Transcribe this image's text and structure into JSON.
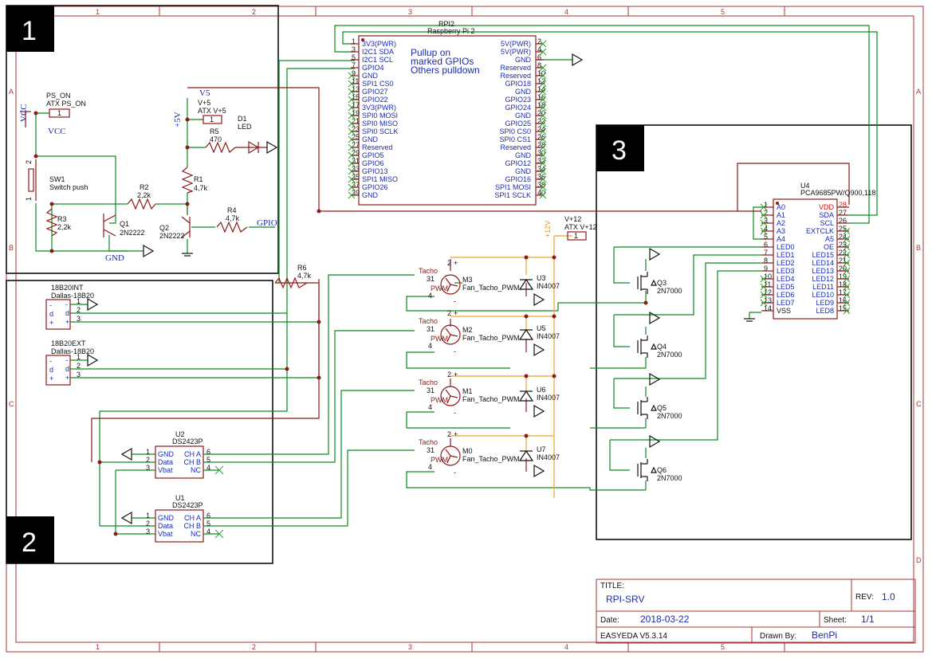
{
  "frame": {
    "cols": [
      "1",
      "2",
      "3",
      "4",
      "5"
    ],
    "rows": [
      "A",
      "B",
      "C",
      "D"
    ]
  },
  "sections": [
    "1",
    "2",
    "3"
  ],
  "title_block": {
    "title_label": "TITLE:",
    "title": "RPI-SRV",
    "rev_label": "REV:",
    "rev": "1.0",
    "date_label": "Date:",
    "date": "2018-03-22",
    "sheet_label": "Sheet:",
    "sheet": "1/1",
    "tool": "EASYEDA V5.3.14",
    "drawn_label": "Drawn By:",
    "drawn": "BenPi"
  },
  "rpi": {
    "ref": "RPI2",
    "name": "Raspberry Pi 2",
    "note1": "Pullup on",
    "note2": "marked GPIOs",
    "note3": "Others pulldown",
    "left_pins": [
      {
        "n": "1",
        "name": "3V3(PWR)"
      },
      {
        "n": "3",
        "name": "I2C1 SDA"
      },
      {
        "n": "5",
        "name": "I2C1 SCL"
      },
      {
        "n": "7",
        "name": "GPIO4"
      },
      {
        "n": "9",
        "name": "GND"
      },
      {
        "n": "11",
        "name": "SPI1 CS0"
      },
      {
        "n": "13",
        "name": "GPIO27"
      },
      {
        "n": "15",
        "name": "GPIO22"
      },
      {
        "n": "17",
        "name": "3V3(PWR)"
      },
      {
        "n": "19",
        "name": "SPI0 MOSI"
      },
      {
        "n": "21",
        "name": "SPI0 MISO"
      },
      {
        "n": "23",
        "name": "SPI0 SCLK"
      },
      {
        "n": "25",
        "name": "GND"
      },
      {
        "n": "27",
        "name": "Reserved"
      },
      {
        "n": "29",
        "name": "GPIO5"
      },
      {
        "n": "31",
        "name": "GPIO6"
      },
      {
        "n": "33",
        "name": "GPIO13"
      },
      {
        "n": "35",
        "name": "SPI1 MISO"
      },
      {
        "n": "37",
        "name": "GPIO26"
      },
      {
        "n": "39",
        "name": "GND"
      }
    ],
    "right_pins": [
      {
        "n": "2",
        "name": "5V(PWR)"
      },
      {
        "n": "4",
        "name": "5V(PWR)"
      },
      {
        "n": "6",
        "name": "GND"
      },
      {
        "n": "8",
        "name": "Reserved"
      },
      {
        "n": "10",
        "name": "Reserved"
      },
      {
        "n": "12",
        "name": "GPIO18"
      },
      {
        "n": "14",
        "name": "GND"
      },
      {
        "n": "16",
        "name": "GPIO23"
      },
      {
        "n": "18",
        "name": "GPIO24"
      },
      {
        "n": "20",
        "name": "GND"
      },
      {
        "n": "22",
        "name": "GPIO25"
      },
      {
        "n": "24",
        "name": "SPI0 CS0"
      },
      {
        "n": "26",
        "name": "SPI0 CS1"
      },
      {
        "n": "28",
        "name": "Reserved"
      },
      {
        "n": "30",
        "name": "GND"
      },
      {
        "n": "32",
        "name": "GPIO12"
      },
      {
        "n": "34",
        "name": "GND"
      },
      {
        "n": "36",
        "name": "GPIO16"
      },
      {
        "n": "38",
        "name": "SPI1 MOSI"
      },
      {
        "n": "40",
        "name": "SPI1 SCLK"
      }
    ]
  },
  "pca": {
    "ref": "U4",
    "name": "PCA9685PW/Q900,118",
    "left_pins": [
      {
        "n": "1",
        "name": "A0"
      },
      {
        "n": "2",
        "name": "A1"
      },
      {
        "n": "3",
        "name": "A2"
      },
      {
        "n": "4",
        "name": "A3"
      },
      {
        "n": "5",
        "name": "A4"
      },
      {
        "n": "6",
        "name": "LED0"
      },
      {
        "n": "7",
        "name": "LED1"
      },
      {
        "n": "8",
        "name": "LED2"
      },
      {
        "n": "9",
        "name": "LED3"
      },
      {
        "n": "10",
        "name": "LED4"
      },
      {
        "n": "11",
        "name": "LED5"
      },
      {
        "n": "12",
        "name": "LED6"
      },
      {
        "n": "13",
        "name": "LED7"
      },
      {
        "n": "14",
        "name": "VSS"
      }
    ],
    "right_pins": [
      {
        "n": "28",
        "name": "VDD"
      },
      {
        "n": "27",
        "name": "SDA"
      },
      {
        "n": "26",
        "name": "SCL"
      },
      {
        "n": "25",
        "name": "EXTCLK"
      },
      {
        "n": "24",
        "name": "A5"
      },
      {
        "n": "23",
        "name": "OE"
      },
      {
        "n": "22",
        "name": "LED15"
      },
      {
        "n": "21",
        "name": "LED14"
      },
      {
        "n": "20",
        "name": "LED13"
      },
      {
        "n": "19",
        "name": "LED12"
      },
      {
        "n": "18",
        "name": "LED11"
      },
      {
        "n": "17",
        "name": "LED10"
      },
      {
        "n": "16",
        "name": "LED9"
      },
      {
        "n": "15",
        "name": "LED8"
      }
    ]
  },
  "power": {
    "ps_on_ref": "PS_ON",
    "ps_on_name": "ATX PS_ON",
    "ps_on_pin": "1",
    "vcc_port": "VCC",
    "vcc_net": "VCC",
    "v5_ref": "V+5",
    "v5_name": "ATX V+5",
    "v5_pin": "1",
    "v5_port": "+5V",
    "v5_net": "V5",
    "v12_ref": "V+12",
    "v12_name": "ATX V+12",
    "v12_pin": "1",
    "v12_port": "+12V",
    "gnd_net": "GND",
    "gpio_net": "GPIO"
  },
  "parts": {
    "sw1_ref": "SW1",
    "sw1_name": "Switch push",
    "sw1_p1": "1",
    "sw1_p2": "2",
    "r2_ref": "R2",
    "r2_val": "2,2k",
    "r3_ref": "R3",
    "r3_val": "2,2k",
    "q1_ref": "Q1",
    "q1_val": "2N2222",
    "q2_ref": "Q2",
    "q2_val": "2N2222",
    "r1_ref": "R1",
    "r1_val": "4,7k",
    "r4_ref": "R4",
    "r4_val": "4,7k",
    "r5_ref": "R5",
    "r5_val": "470",
    "d1_ref": "D1",
    "d1_val": "LED",
    "r6_ref": "R6",
    "r6_val": "4,7k",
    "ds1_ref": "18B20INT",
    "ds1_val": "Dallas-18B20",
    "ds2_ref": "18B20EXT",
    "ds2_val": "Dallas-18B20",
    "ds_pins": [
      "1",
      "2",
      "3"
    ],
    "ds_pin_labels": [
      "-",
      "d",
      "+"
    ],
    "u2_ref": "U2",
    "u1_ref": "U1",
    "ds2423_val": "DS2423P",
    "ds2423_left": [
      {
        "n": "1",
        "name": "GND"
      },
      {
        "n": "2",
        "name": "Data"
      },
      {
        "n": "3",
        "name": "Vbat"
      }
    ],
    "ds2423_right": [
      {
        "n": "6",
        "name": "CH A"
      },
      {
        "n": "5",
        "name": "CH B"
      },
      {
        "n": "4",
        "name": "NC"
      }
    ]
  },
  "fans": [
    {
      "ref": "M3",
      "val": "Fan_Tacho_PWM",
      "diode_ref": "U3",
      "diode_val": "IN4007"
    },
    {
      "ref": "M2",
      "val": "Fan_Tacho_PWM",
      "diode_ref": "U5",
      "diode_val": "IN4007"
    },
    {
      "ref": "M1",
      "val": "Fan_Tacho_PWM",
      "diode_ref": "U6",
      "diode_val": "IN4007"
    },
    {
      "ref": "M0",
      "val": "Fan_Tacho_PWM",
      "diode_ref": "U7",
      "diode_val": "IN4007"
    }
  ],
  "fan_labels": {
    "tacho": "Tacho",
    "pwm": "PWM",
    "p1": "1",
    "p2": "2",
    "p3": "3",
    "p4": "4",
    "plus": "+",
    "minus": "-"
  },
  "mosfets": [
    {
      "ref": "Q3",
      "val": "2N7000"
    },
    {
      "ref": "Q4",
      "val": "2N7000"
    },
    {
      "ref": "Q5",
      "val": "2N7000"
    },
    {
      "ref": "Q6",
      "val": "2N7000"
    }
  ]
}
